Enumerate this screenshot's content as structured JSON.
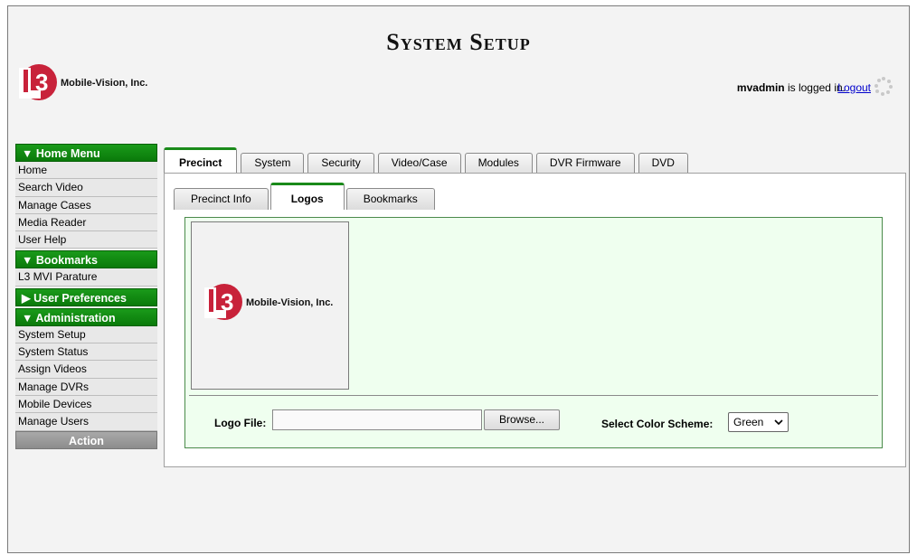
{
  "app": {
    "title": "System Setup",
    "logo_text": "Mobile-Vision, Inc.",
    "logo_mark_text": "3"
  },
  "header": {
    "username": "mvadmin",
    "logged_in_suffix": " is logged in.",
    "logout_label": "Logout"
  },
  "sidebar": {
    "home_menu": {
      "label": "▼ Home Menu",
      "items": [
        "Home",
        "Search Video",
        "Manage Cases",
        "Media Reader",
        "User Help"
      ]
    },
    "bookmarks": {
      "label": "▼ Bookmarks",
      "items": [
        "L3 MVI Parature"
      ]
    },
    "user_preferences": {
      "label": "▶ User Preferences"
    },
    "administration": {
      "label": "▼ Administration",
      "items": [
        "System Setup",
        "System Status",
        "Assign Videos",
        "Manage DVRs",
        "Mobile Devices",
        "Manage Users"
      ]
    },
    "action": {
      "label": "Action"
    }
  },
  "main_tabs": [
    "Precinct",
    "System",
    "Security",
    "Video/Case",
    "Modules",
    "DVR Firmware",
    "DVD"
  ],
  "active_main_tab": "Precinct",
  "sub_tabs": [
    "Precinct Info",
    "Logos",
    "Bookmarks"
  ],
  "active_sub_tab": "Logos",
  "logos": {
    "logo_file_label": "Logo File:",
    "logo_file_value": "",
    "browse_label": "Browse...",
    "color_scheme_label": "Select Color Scheme:",
    "color_scheme_value": "Green"
  },
  "colors": {
    "accent_green": "#0a7a0a",
    "logo_red": "#c8223a",
    "logo_area_bg": "#efffef",
    "link_blue": "#0000cc"
  },
  "icons": [
    "loading-spinner-icon",
    "chevron-down-icon",
    "l3-logo-icon"
  ]
}
